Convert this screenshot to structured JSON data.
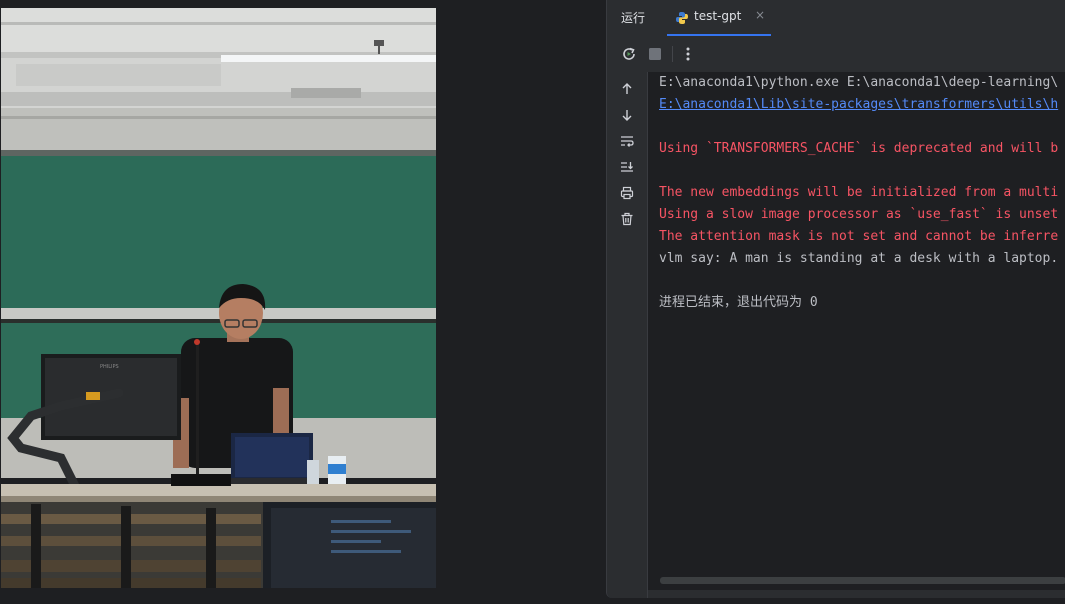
{
  "run_panel": {
    "title": "运行",
    "tab": {
      "label": "test-gpt",
      "close": "×"
    },
    "toolbar": [
      {
        "icon": "rerun-icon"
      },
      {
        "icon": "stop-icon"
      },
      {
        "icon": "more-vertical-icon"
      }
    ],
    "gutter": [
      {
        "icon": "scroll-up-icon"
      },
      {
        "icon": "scroll-down-icon"
      },
      {
        "icon": "soft-wrap-icon"
      },
      {
        "icon": "scroll-to-end-icon"
      },
      {
        "icon": "print-icon"
      },
      {
        "icon": "trash-icon"
      }
    ],
    "console_lines": [
      {
        "text": "E:\\anaconda1\\python.exe E:\\anaconda1\\deep-learning\\",
        "style": "normal"
      },
      {
        "text": "E:\\anaconda1\\Lib\\site-packages\\transformers\\utils\\h",
        "style": "link"
      },
      {
        "text": "",
        "style": "normal"
      },
      {
        "text": "Using `TRANSFORMERS_CACHE` is deprecated and will b",
        "style": "error"
      },
      {
        "text": "",
        "style": "normal"
      },
      {
        "text": "The new embeddings will be initialized from a multi",
        "style": "error"
      },
      {
        "text": "Using a slow image processor as `use_fast` is unset",
        "style": "error"
      },
      {
        "text": "The attention mask is not set and cannot be inferre",
        "style": "error"
      },
      {
        "text": "vlm say: A man is standing at a desk with a laptop.",
        "style": "normal"
      },
      {
        "text": "",
        "style": "normal"
      },
      {
        "text": "进程已结束，退出代码为 0",
        "style": "normal"
      }
    ],
    "colors": {
      "error": "#f75464",
      "link": "#548af7",
      "normal": "#bcbec4",
      "accent": "#3574f0"
    }
  },
  "photo": {
    "monitor_brand": "PHILIPS"
  }
}
